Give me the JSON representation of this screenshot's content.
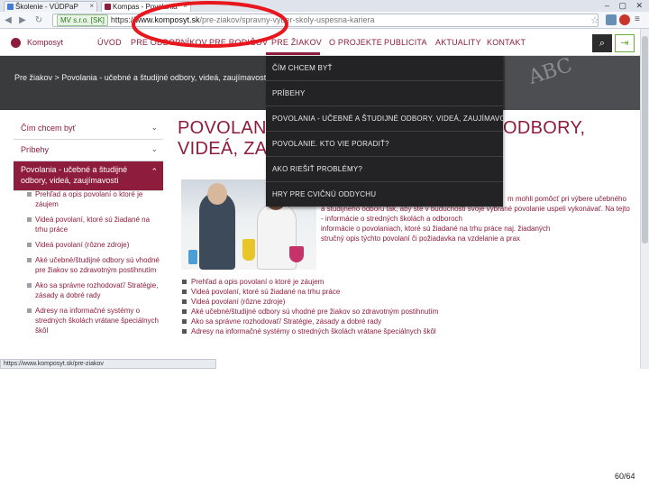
{
  "browser": {
    "tabs": [
      {
        "label": "Školenie - VÚDPaP",
        "active": false
      },
      {
        "label": "Kompas - Povolania",
        "active": true
      }
    ],
    "url": {
      "ssl_label": "MV s.r.o. [SK]",
      "scheme": "https://",
      "host": "www.komposyt.sk",
      "path": "/pre-ziakov/spravny-vyber-skoly-uspesna-kariera"
    },
    "status_url": "https://www.komposyt.sk/pre-ziakov",
    "icons": {
      "back": "arrow-left",
      "forward": "arrow-right",
      "reload": "refresh",
      "star": "star",
      "window": "minimize-maximize-close"
    }
  },
  "site": {
    "logo": "Komposyt",
    "nav": [
      "ÚVOD",
      "PRE ODBORNÍKOV",
      "PRE RODIČOV",
      "PRE ŽIAKOV",
      "O PROJEKTE",
      "PUBLICITA",
      "AKTUALITY",
      "KONTAKT"
    ],
    "active_nav": "PRE ŽIAKOV",
    "accent_color": "#8e1c3c"
  },
  "hero": {
    "breadcrumb": "Pre žiakov > Povolania - učebné a študijné odbory, videá, zaujímavosti",
    "deco_text": "ABC"
  },
  "dropdown": [
    "ČÍM CHCEM BYŤ",
    "PRÍBEHY",
    "POVOLANIA - UČEBNÉ A ŠTUDIJNÉ ODBORY, VIDEÁ, ZAUJÍMAVOSTI",
    "POVOLANIE. KTO VIE PORADIŤ?",
    "AKO RIEŠIŤ PROBLÉMY?",
    "HRY PRE CVIČNÚ ODDYCHU"
  ],
  "sidebar": {
    "items": [
      "Čím chcem byť",
      "Príbehy",
      "Povolania - učebné a študijné odbory, videá, zaujímavosti"
    ],
    "sub_items": [
      "Prehľad a opis povolaní o ktoré je záujem",
      "Videá povolaní, ktoré sú žiadané na trhu práce",
      "Videá povolaní (rôzne zdroje)",
      "Aké učebné/študijné odbory sú vhodné pre žiakov so zdravotným postihnutím",
      "Ako sa správne rozhodovať/ Stratégie, zásady a dobré rady",
      "Adresy na informačné systémy o stredných školách vrátane špeciálnych škôl"
    ]
  },
  "main": {
    "title_line1": "POVOLAN",
    "title_line1_right": "ODBORY,",
    "title_line2": "VIDEÁ, ZA",
    "intro": [
      "m mohli pomôcť pri výbere učebného",
      "a študijného odboru tak, aby ste v budúcnosti svoje vybrané povolanie uspeli vykonávať. Na tejto",
      "- informácie o stredných školách a odboroch",
      "  informácie o povolaniach, ktoré sú žiadané na trhu práce naj. žiadaných",
      "  stručný opis týchto povolaní či požiadavka na vzdelanie a prax"
    ],
    "bullets": [
      "Prehľad a opis povolaní o ktoré je záujem",
      "Videá povolaní, ktoré sú žiadané na trhu práce",
      "Videá povolaní (rôzne zdroje)",
      "Aké učebné/študijné odbory sú vhodné pre žiakov so zdravotným postihnutím",
      "Ako sa správne rozhodovať/ Stratégie, zásady a dobré rady",
      "Adresy na informačné systémy o stredných školách vrátane špeciálnych škôl"
    ]
  },
  "page_number": "60/64"
}
